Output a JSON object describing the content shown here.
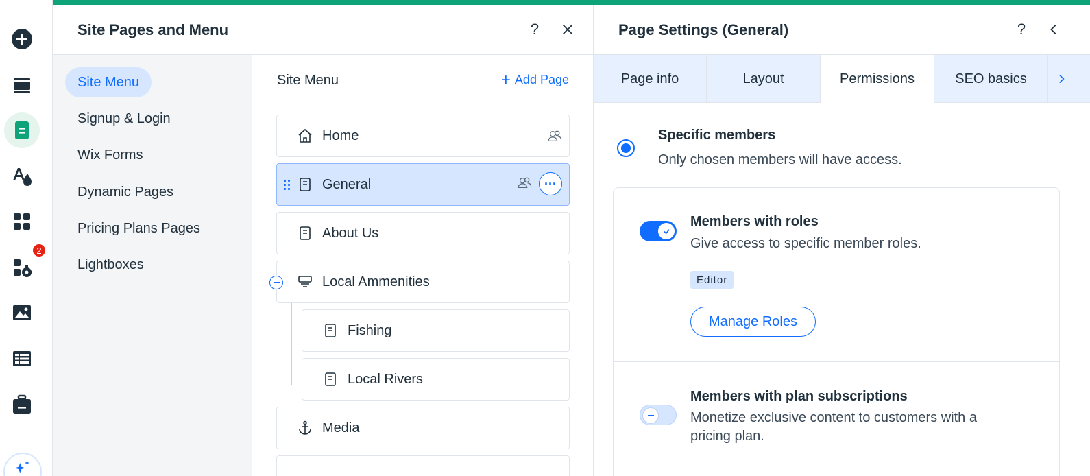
{
  "rail": {
    "items": [
      {
        "icon": "add-circle-icon"
      },
      {
        "icon": "sections-icon"
      },
      {
        "icon": "pages-icon",
        "active": true
      },
      {
        "icon": "design-icon"
      },
      {
        "icon": "apps-icon"
      },
      {
        "icon": "business-apps-icon",
        "badge": "2"
      },
      {
        "icon": "media-icon"
      },
      {
        "icon": "cms-icon"
      },
      {
        "icon": "portfolio-icon"
      }
    ]
  },
  "colors": {
    "accent": "#116dff",
    "brand_green": "#0fa37a",
    "badge": "#e62214"
  },
  "site_pages_panel": {
    "title": "Site Pages and Menu",
    "help_icon": "?",
    "nav": [
      "Site Menu",
      "Signup & Login",
      "Wix Forms",
      "Dynamic Pages",
      "Pricing Plans Pages",
      "Lightboxes"
    ],
    "list_title": "Site Menu",
    "add_page_label": "Add Page",
    "pages": [
      {
        "label": "Home",
        "icon": "home-icon",
        "members": true
      },
      {
        "label": "General",
        "icon": "page-icon",
        "members": true,
        "selected": true
      },
      {
        "label": "About Us",
        "icon": "page-icon"
      },
      {
        "label": "Local Ammenities",
        "icon": "folder-page-icon"
      },
      {
        "label": "Fishing",
        "icon": "page-icon",
        "child": true
      },
      {
        "label": "Local Rivers",
        "icon": "page-icon",
        "child": true
      },
      {
        "label": "Media",
        "icon": "anchor-icon"
      }
    ]
  },
  "page_settings": {
    "title": "Page Settings (General)",
    "help_icon": "?",
    "tabs": [
      "Page info",
      "Layout",
      "Permissions",
      "SEO basics"
    ],
    "active_tab": "Permissions",
    "option": {
      "title": "Specific members",
      "desc": "Only chosen members will have access."
    },
    "roles": {
      "title": "Members with roles",
      "desc": "Give access to specific member roles.",
      "tag": "Editor",
      "button": "Manage Roles",
      "enabled": true
    },
    "plans": {
      "title": "Members with plan subscriptions",
      "desc_line1": "Monetize exclusive content to customers with a",
      "desc_line2": "pricing plan.",
      "enabled": false
    }
  }
}
